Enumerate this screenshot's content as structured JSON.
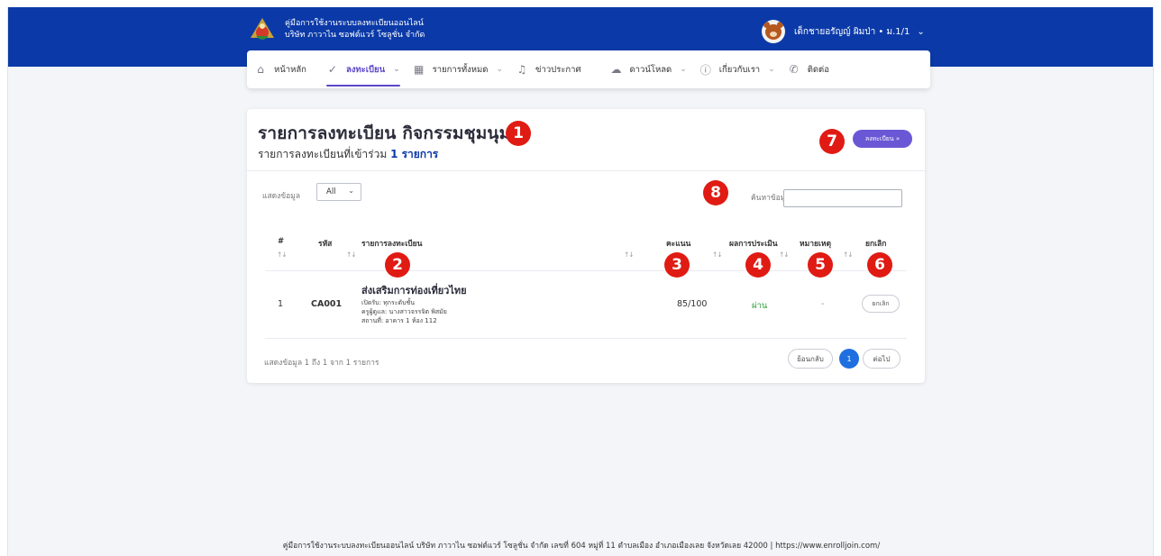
{
  "header": {
    "manual_title": "คู่มือการใช้งานระบบลงทะเบียนออนไลน์",
    "company": "บริษัท ภาวาไน ซอฟต์แวร์ โซลูชั่น จำกัด",
    "user_name": "เด็กชายอรัญญ์ ผิมป่า • ม.1/1"
  },
  "nav": {
    "items": [
      {
        "label": "หน้าหลัก",
        "icon": "home-icon"
      },
      {
        "label": "ลงทะเบียน",
        "icon": "check-circle-icon",
        "active": true
      },
      {
        "label": "รายการทั้งหมด",
        "icon": "grid-icon"
      },
      {
        "label": "ข่าวประกาศ",
        "icon": "bell-icon"
      },
      {
        "label": "ดาวน์โหลด",
        "icon": "cloud-download-icon"
      },
      {
        "label": "เกี่ยวกับเรา",
        "icon": "info-icon"
      },
      {
        "label": "ติดต่อ",
        "icon": "phone-icon"
      }
    ]
  },
  "page": {
    "title": "รายการลงทะเบียน กิจกรรมชุมนุม",
    "subtitle_prefix": "รายการลงทะเบียนที่เข้าร่วม",
    "subtitle_count": "1 รายการ",
    "enroll_button": "ลงทะเบียน »"
  },
  "filters": {
    "show_label": "แสดงข้อมูล",
    "show_value": "All",
    "search_label": "ค้นหาข้อมูล:",
    "search_value": ""
  },
  "table": {
    "headers": [
      "#",
      "รหัส",
      "รายการลงทะเบียน",
      "คะแนน",
      "ผลการประเมิน",
      "หมายเหตุ",
      "ยกเลิก"
    ],
    "rows": [
      {
        "index": "1",
        "code": "CA001",
        "name": "ส่งเสริมการท่องเที่ยวไทย",
        "open_for": "เปิดรับ: ทุกระดับชั้น",
        "teacher": "ครูผู้ดูแล: นางสาวจรรจิต พิสมัย",
        "place": "สถานที่: อาคาร 1 ห้อง 112",
        "score": "85/100",
        "result": "ผ่าน",
        "note": "-",
        "cancel": "ยกเลิก"
      }
    ]
  },
  "pagination": {
    "info": "แสดงข้อมูล 1 ถึง 1 จาก 1 รายการ",
    "prev": "ย้อนกลับ",
    "page": "1",
    "next": "ต่อไป"
  },
  "annotations": [
    "1",
    "2",
    "3",
    "4",
    "5",
    "6",
    "7",
    "8"
  ],
  "footer": {
    "text": "คู่มือการใช้งานระบบลงทะเบียนออนไลน์ บริษัท ภาวาไน ซอฟต์แวร์ โซลูชั่น จำกัด เลขที่ 604 หมู่ที่ 11 ตำบลเมือง อำเภอเมืองเลย จังหวัดเลย 42000 | https://www.enrolljoin.com/"
  },
  "colors": {
    "header_bg": "#0b3aa8",
    "accent": "#5b47c8",
    "badge": "#e01b13",
    "pass": "#2e9e3a"
  }
}
